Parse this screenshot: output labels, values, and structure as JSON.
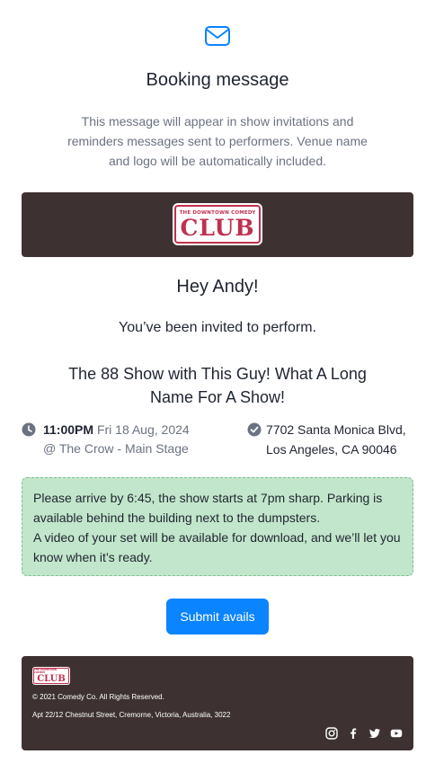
{
  "header": {
    "title": "Booking message",
    "subtitle": "This message will appear in show invitations and reminders messages sent to performers. Venue name and logo will be automatically included."
  },
  "brand": {
    "logo_top": "THE DOWNTOWN COMEDY",
    "logo_main": "CLUB",
    "primary_color": "#c0304f",
    "header_bg": "#3d3231",
    "button_color": "#0a84ff",
    "notes_bg": "#c2e6cb"
  },
  "message": {
    "greeting": "Hey Andy!",
    "invite_text": "You’ve been invited to perform.",
    "show_name": "The 88 Show with This Guy! What A Long Name For A Show!",
    "time": "11:00PM",
    "date": "Fri 18 Aug, 2024",
    "venue": "@ The Crow - Main Stage",
    "address_line1": "7702 Santa Monica Blvd,",
    "address_line2": "Los Angeles, CA 90046",
    "notes_line1": "Please arrive by 6:45, the show starts at 7pm sharp. Parking is available behind the building next to the dumpsters.",
    "notes_line2": "A video of your set will be available for download, and we’ll let you know when it’s ready."
  },
  "actions": {
    "submit_label": "Submit avails"
  },
  "footer": {
    "copyright": "© 2021 Comedy Co. All Rights Reserved.",
    "address": "Apt 22/12 Chestnut Street, Cremorne, Victoria, Australia, 3022",
    "socials": [
      "instagram-icon",
      "facebook-icon",
      "twitter-icon",
      "youtube-icon"
    ]
  }
}
